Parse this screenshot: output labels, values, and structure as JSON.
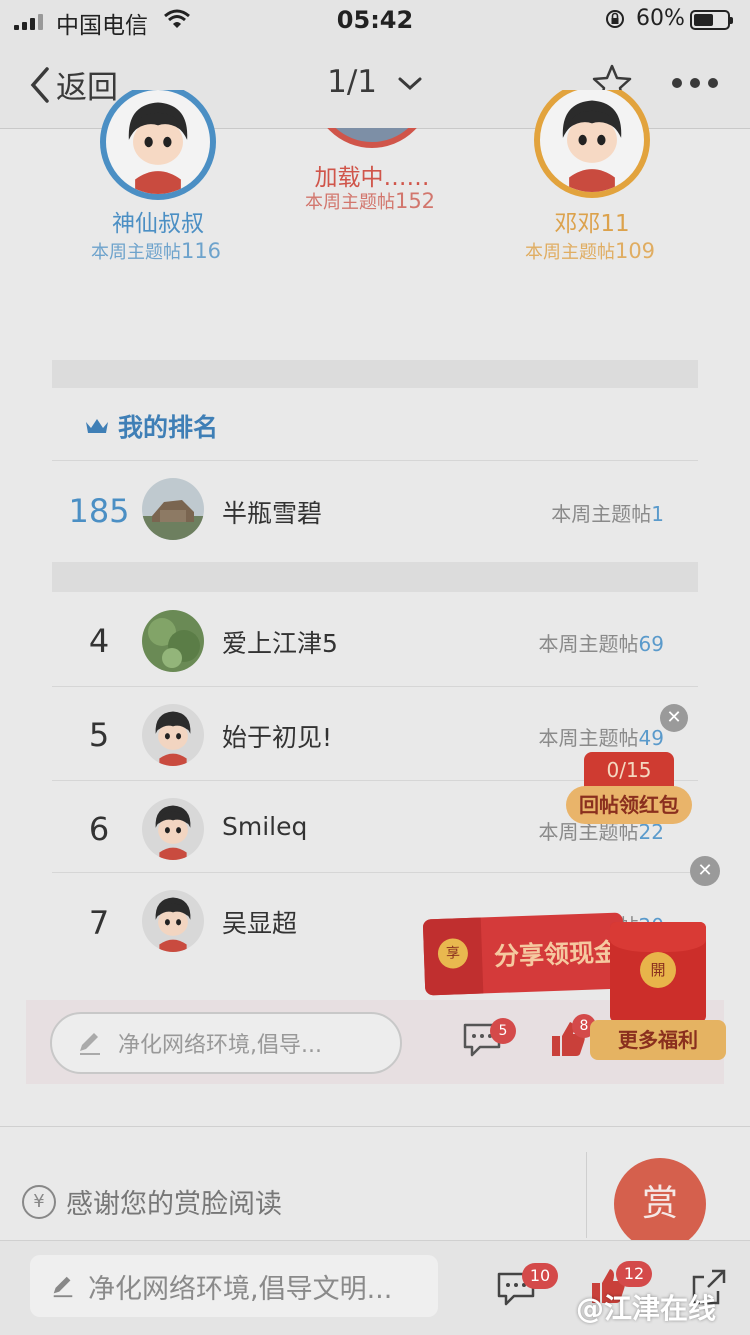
{
  "status_bar": {
    "carrier": "中国电信",
    "time": "05:42",
    "battery_percent": "60%",
    "battery_level": 0.6
  },
  "nav": {
    "back_label": "返回",
    "pager": "1/1"
  },
  "top_users": [
    {
      "name": "神仙叔叔",
      "stat_label": "本周主题帖",
      "stat_value": "116",
      "ring_color": "#4b8fc4"
    },
    {
      "name": "加载中……",
      "stat_label": "本周主题帖",
      "stat_value": "152",
      "ring_color": "#d0554a"
    },
    {
      "name": "邓邓11",
      "stat_label": "本周主题帖",
      "stat_value": "109",
      "ring_color": "#e2a33d"
    }
  ],
  "my_rank": {
    "title": "我的排名",
    "rank": "185",
    "name": "半瓶雪碧",
    "stat_label": "本周主题帖",
    "stat_value": "1"
  },
  "ranking": [
    {
      "rank": "4",
      "name": "爱上江津5",
      "stat_label": "本周主题帖",
      "stat_value": "69"
    },
    {
      "rank": "5",
      "name": "始于初见!",
      "stat_label": "本周主题帖",
      "stat_value": "49"
    },
    {
      "rank": "6",
      "name": "Smileq",
      "stat_label": "本周主题帖",
      "stat_value": "22"
    },
    {
      "rank": "7",
      "name": "吴显超",
      "stat_label": "本周主题帖",
      "stat_value": "20"
    }
  ],
  "inner_bar": {
    "placeholder": "净化网络环境,倡导...",
    "comment_count": "5",
    "like_count": "8"
  },
  "promo": {
    "progress": "0/15",
    "reply_redpack": "回帖领红包",
    "share_cash": "分享领现金",
    "seal_char": "享",
    "open_char": "開",
    "more_benefits": "更多福利"
  },
  "thanks": {
    "symbol": "¥",
    "text": "感谢您的赏脸阅读",
    "reward_label": "赏"
  },
  "bottom_bar": {
    "placeholder": "净化网络环境,倡导文明...",
    "comment_count": "10",
    "like_count": "12"
  },
  "watermark": "@江津在线"
}
